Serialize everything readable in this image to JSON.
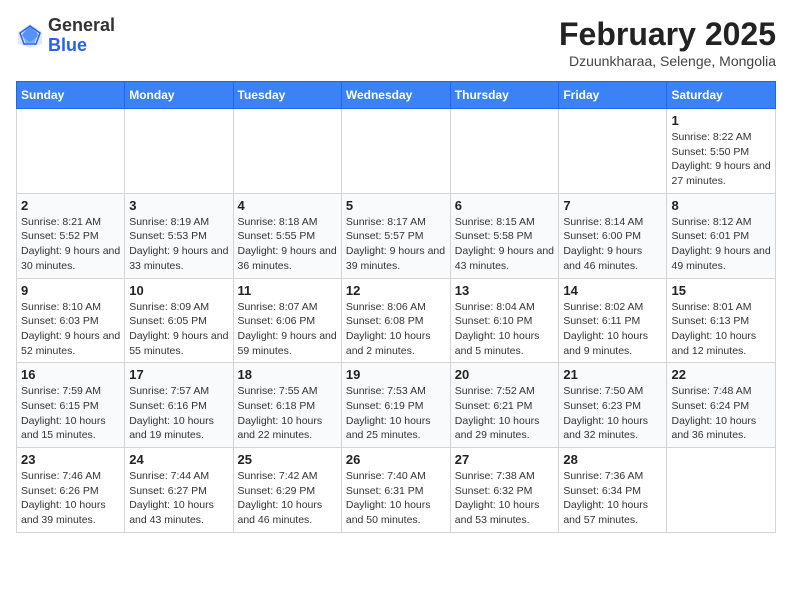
{
  "header": {
    "logo_general": "General",
    "logo_blue": "Blue",
    "month_title": "February 2025",
    "location": "Dzuunkharaa, Selenge, Mongolia"
  },
  "days_of_week": [
    "Sunday",
    "Monday",
    "Tuesday",
    "Wednesday",
    "Thursday",
    "Friday",
    "Saturday"
  ],
  "weeks": [
    [
      {
        "num": "",
        "detail": ""
      },
      {
        "num": "",
        "detail": ""
      },
      {
        "num": "",
        "detail": ""
      },
      {
        "num": "",
        "detail": ""
      },
      {
        "num": "",
        "detail": ""
      },
      {
        "num": "",
        "detail": ""
      },
      {
        "num": "1",
        "detail": "Sunrise: 8:22 AM\nSunset: 5:50 PM\nDaylight: 9 hours and 27 minutes."
      }
    ],
    [
      {
        "num": "2",
        "detail": "Sunrise: 8:21 AM\nSunset: 5:52 PM\nDaylight: 9 hours and 30 minutes."
      },
      {
        "num": "3",
        "detail": "Sunrise: 8:19 AM\nSunset: 5:53 PM\nDaylight: 9 hours and 33 minutes."
      },
      {
        "num": "4",
        "detail": "Sunrise: 8:18 AM\nSunset: 5:55 PM\nDaylight: 9 hours and 36 minutes."
      },
      {
        "num": "5",
        "detail": "Sunrise: 8:17 AM\nSunset: 5:57 PM\nDaylight: 9 hours and 39 minutes."
      },
      {
        "num": "6",
        "detail": "Sunrise: 8:15 AM\nSunset: 5:58 PM\nDaylight: 9 hours and 43 minutes."
      },
      {
        "num": "7",
        "detail": "Sunrise: 8:14 AM\nSunset: 6:00 PM\nDaylight: 9 hours and 46 minutes."
      },
      {
        "num": "8",
        "detail": "Sunrise: 8:12 AM\nSunset: 6:01 PM\nDaylight: 9 hours and 49 minutes."
      }
    ],
    [
      {
        "num": "9",
        "detail": "Sunrise: 8:10 AM\nSunset: 6:03 PM\nDaylight: 9 hours and 52 minutes."
      },
      {
        "num": "10",
        "detail": "Sunrise: 8:09 AM\nSunset: 6:05 PM\nDaylight: 9 hours and 55 minutes."
      },
      {
        "num": "11",
        "detail": "Sunrise: 8:07 AM\nSunset: 6:06 PM\nDaylight: 9 hours and 59 minutes."
      },
      {
        "num": "12",
        "detail": "Sunrise: 8:06 AM\nSunset: 6:08 PM\nDaylight: 10 hours and 2 minutes."
      },
      {
        "num": "13",
        "detail": "Sunrise: 8:04 AM\nSunset: 6:10 PM\nDaylight: 10 hours and 5 minutes."
      },
      {
        "num": "14",
        "detail": "Sunrise: 8:02 AM\nSunset: 6:11 PM\nDaylight: 10 hours and 9 minutes."
      },
      {
        "num": "15",
        "detail": "Sunrise: 8:01 AM\nSunset: 6:13 PM\nDaylight: 10 hours and 12 minutes."
      }
    ],
    [
      {
        "num": "16",
        "detail": "Sunrise: 7:59 AM\nSunset: 6:15 PM\nDaylight: 10 hours and 15 minutes."
      },
      {
        "num": "17",
        "detail": "Sunrise: 7:57 AM\nSunset: 6:16 PM\nDaylight: 10 hours and 19 minutes."
      },
      {
        "num": "18",
        "detail": "Sunrise: 7:55 AM\nSunset: 6:18 PM\nDaylight: 10 hours and 22 minutes."
      },
      {
        "num": "19",
        "detail": "Sunrise: 7:53 AM\nSunset: 6:19 PM\nDaylight: 10 hours and 25 minutes."
      },
      {
        "num": "20",
        "detail": "Sunrise: 7:52 AM\nSunset: 6:21 PM\nDaylight: 10 hours and 29 minutes."
      },
      {
        "num": "21",
        "detail": "Sunrise: 7:50 AM\nSunset: 6:23 PM\nDaylight: 10 hours and 32 minutes."
      },
      {
        "num": "22",
        "detail": "Sunrise: 7:48 AM\nSunset: 6:24 PM\nDaylight: 10 hours and 36 minutes."
      }
    ],
    [
      {
        "num": "23",
        "detail": "Sunrise: 7:46 AM\nSunset: 6:26 PM\nDaylight: 10 hours and 39 minutes."
      },
      {
        "num": "24",
        "detail": "Sunrise: 7:44 AM\nSunset: 6:27 PM\nDaylight: 10 hours and 43 minutes."
      },
      {
        "num": "25",
        "detail": "Sunrise: 7:42 AM\nSunset: 6:29 PM\nDaylight: 10 hours and 46 minutes."
      },
      {
        "num": "26",
        "detail": "Sunrise: 7:40 AM\nSunset: 6:31 PM\nDaylight: 10 hours and 50 minutes."
      },
      {
        "num": "27",
        "detail": "Sunrise: 7:38 AM\nSunset: 6:32 PM\nDaylight: 10 hours and 53 minutes."
      },
      {
        "num": "28",
        "detail": "Sunrise: 7:36 AM\nSunset: 6:34 PM\nDaylight: 10 hours and 57 minutes."
      },
      {
        "num": "",
        "detail": ""
      }
    ]
  ]
}
